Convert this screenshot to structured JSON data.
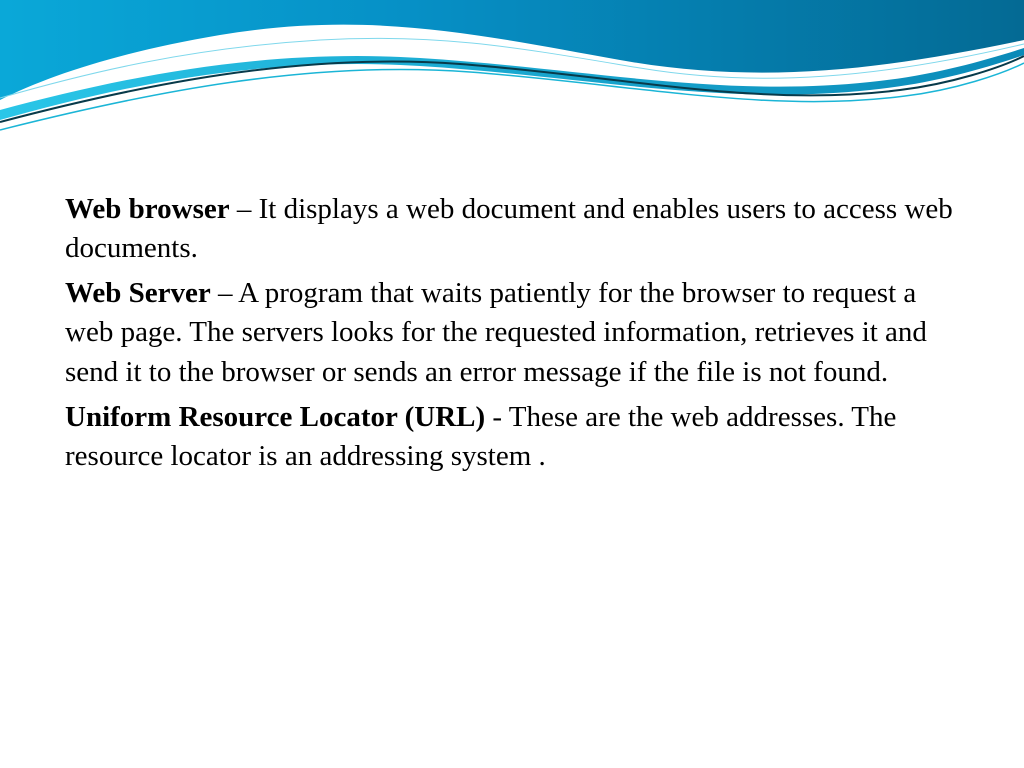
{
  "definitions": {
    "web_browser": {
      "term": "Web browser",
      "sep": " – ",
      "desc": "It  displays a web document and enables users to access web documents."
    },
    "web_server": {
      "term": "Web Server",
      "sep": " – ",
      "desc": "A program that waits patiently for the browser to request a web page. The servers looks for the requested information, retrieves it and send it to the browser or sends an error message if the file is not found."
    },
    "url": {
      "term": "Uniform Resource Locator (URL)",
      "sep": " - ",
      "desc": "These are the web addresses. The resource locator is an addressing system ."
    }
  }
}
